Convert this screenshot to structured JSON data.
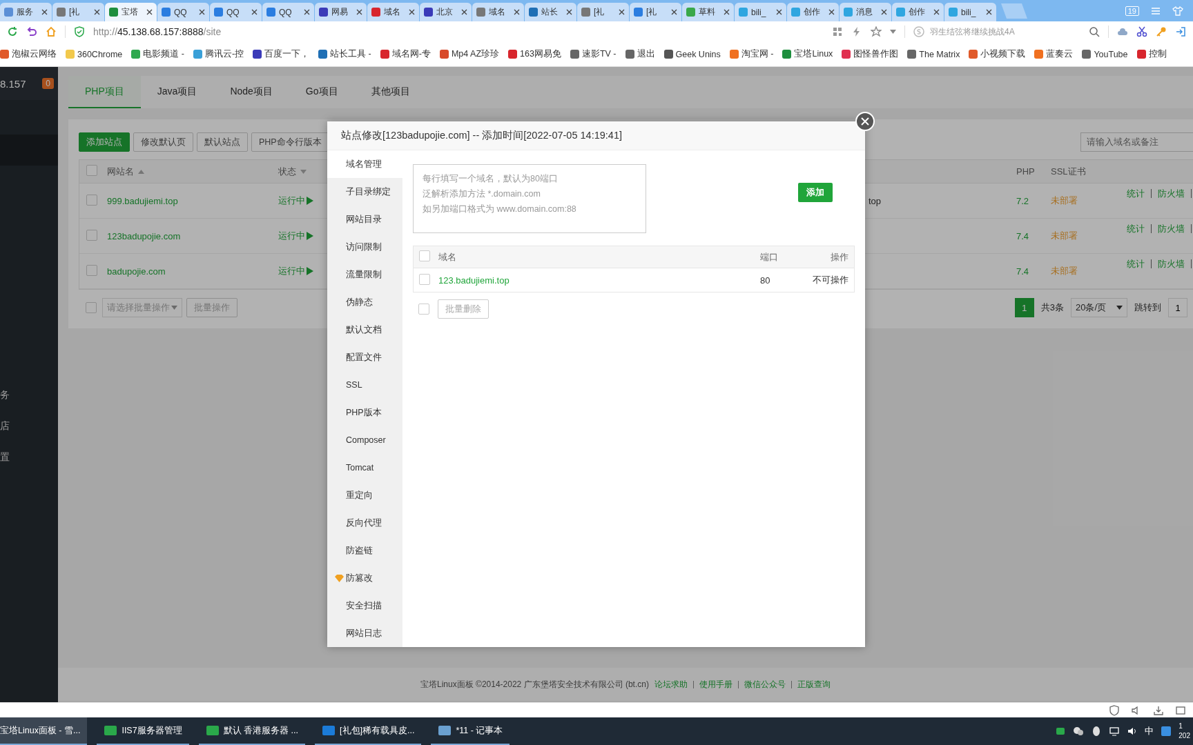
{
  "browser": {
    "tabs": [
      {
        "title": "服务",
        "color": "#5b8fd6",
        "selected": false
      },
      {
        "title": "[礼",
        "color": "#777777",
        "selected": false
      },
      {
        "title": "宝塔",
        "color": "#1e8e3e",
        "selected": true
      },
      {
        "title": "QQ",
        "color": "#2b7de0",
        "selected": false
      },
      {
        "title": "QQ",
        "color": "#2b7de0",
        "selected": false
      },
      {
        "title": "QQ",
        "color": "#2b7de0",
        "selected": false
      },
      {
        "title": "网易",
        "color": "#3b3bb8",
        "selected": false
      },
      {
        "title": "域名",
        "color": "#d8262d",
        "selected": false
      },
      {
        "title": "北京",
        "color": "#3b3bb8",
        "selected": false
      },
      {
        "title": "域名",
        "color": "#777777",
        "selected": false
      },
      {
        "title": "站长",
        "color": "#1f6fb5",
        "selected": false
      },
      {
        "title": "[礼",
        "color": "#777777",
        "selected": false
      },
      {
        "title": "[礼",
        "color": "#2b7de0",
        "selected": false
      },
      {
        "title": "草料",
        "color": "#3aa84a",
        "selected": false
      },
      {
        "title": "bili_",
        "color": "#2fa6e0",
        "selected": false
      },
      {
        "title": "创作",
        "color": "#2fa6e0",
        "selected": false
      },
      {
        "title": "消息",
        "color": "#2fa6e0",
        "selected": false
      },
      {
        "title": "创作",
        "color": "#2fa6e0",
        "selected": false
      },
      {
        "title": "bili_",
        "color": "#2fa6e0",
        "selected": false
      }
    ],
    "tab_count": "19",
    "address": {
      "scheme": "http://",
      "host": "45.138.68.157:8888",
      "path": "/site"
    },
    "search": {
      "placeholder": "羽生结弦将继续挑战4A"
    },
    "bookmarks": [
      {
        "label": "泡椒云网络",
        "color": "#e05a2a"
      },
      {
        "label": "360Chrome",
        "color": "#f2c94c"
      },
      {
        "label": "电影频道 -",
        "color": "#2fa84f"
      },
      {
        "label": "腾讯云-控",
        "color": "#3aa0d8"
      },
      {
        "label": "百度一下，",
        "color": "#3b3bb8"
      },
      {
        "label": "站长工具 -",
        "color": "#1f6fb5"
      },
      {
        "label": "域名网-专",
        "color": "#d8262d"
      },
      {
        "label": "Mp4 AZ珍珍",
        "color": "#d84a2a"
      },
      {
        "label": "163网易免",
        "color": "#d8262d"
      },
      {
        "label": "速影TV -",
        "color": "#666666"
      },
      {
        "label": "退出",
        "color": "#666666"
      },
      {
        "label": "Geek Unins",
        "color": "#555555"
      },
      {
        "label": "淘宝网 -",
        "color": "#f07020"
      },
      {
        "label": "宝塔Linux",
        "color": "#1e8e3e"
      },
      {
        "label": "图怪兽作图",
        "color": "#e03050"
      },
      {
        "label": "The Matrix",
        "color": "#666666"
      },
      {
        "label": "小视频下载",
        "color": "#e05a2a"
      },
      {
        "label": "蓝奏云",
        "color": "#f07020"
      },
      {
        "label": "YouTube",
        "color": "#666666"
      },
      {
        "label": "控制",
        "color": "#d8262d"
      }
    ]
  },
  "sidebar": {
    "server": "8.157",
    "badge": "0",
    "items": [
      {
        "label": "务"
      },
      {
        "label": "店"
      },
      {
        "label": "置"
      }
    ]
  },
  "project_tabs": [
    {
      "label": "PHP项目",
      "selected": true
    },
    {
      "label": "Java项目",
      "selected": false
    },
    {
      "label": "Node项目",
      "selected": false
    },
    {
      "label": "Go项目",
      "selected": false
    },
    {
      "label": "其他项目",
      "selected": false
    }
  ],
  "toolbar": {
    "buttons": [
      {
        "label": "添加站点",
        "kind": "primary"
      },
      {
        "label": "修改默认页",
        "kind": "default"
      },
      {
        "label": "默认站点",
        "kind": "default"
      },
      {
        "label": "PHP命令行版本",
        "kind": "default"
      }
    ],
    "search": {
      "placeholder": "请输入域名或备注"
    }
  },
  "sites_table": {
    "select_all": {
      "checked": false
    },
    "columns": [
      {
        "label": "网站名",
        "kind": "sort_up"
      },
      {
        "label": "状态",
        "kind": "sort_down"
      },
      {
        "label": "PHP",
        "kind": "plain"
      },
      {
        "label": "SSL证书",
        "kind": "plain"
      }
    ],
    "rows": [
      {
        "checked": false,
        "name": "999.badujiemi.top",
        "status": "运行中",
        "column_3": "top",
        "php": "7.2",
        "ssl": "未部署",
        "actions": [
          "统计",
          "防火墙"
        ]
      },
      {
        "checked": false,
        "name": "123badupojie.com",
        "status": "运行中",
        "php": "7.4",
        "ssl": "未部署",
        "actions": [
          "统计",
          "防火墙"
        ]
      },
      {
        "checked": false,
        "name": "badupojie.com",
        "status": "运行中",
        "php": "7.4",
        "ssl": "未部署",
        "actions": [
          "统计",
          "防火墙"
        ]
      }
    ]
  },
  "batch": {
    "checked": false,
    "placeholder": "请选择批量操作",
    "button": {
      "label": "批量操作",
      "disabled": true
    }
  },
  "pagination": {
    "pages": [
      {
        "label": "1",
        "selected": true
      }
    ],
    "total": "共3条",
    "page_size": "20条/页",
    "jump_label": "跳转到",
    "jump_value": "1"
  },
  "dialog": {
    "title": "站点修改[123badupojie.com] -- 添加时间[2022-07-05 14:19:41]",
    "menu": [
      {
        "label": "域名管理",
        "selected": true,
        "kind": "plain"
      },
      {
        "label": "子目录绑定",
        "selected": false,
        "kind": "plain"
      },
      {
        "label": "网站目录",
        "selected": false,
        "kind": "plain"
      },
      {
        "label": "访问限制",
        "selected": false,
        "kind": "plain"
      },
      {
        "label": "流量限制",
        "selected": false,
        "kind": "plain"
      },
      {
        "label": "伪静态",
        "selected": false,
        "kind": "plain"
      },
      {
        "label": "默认文档",
        "selected": false,
        "kind": "plain"
      },
      {
        "label": "配置文件",
        "selected": false,
        "kind": "plain"
      },
      {
        "label": "SSL",
        "selected": false,
        "kind": "plain"
      },
      {
        "label": "PHP版本",
        "selected": false,
        "kind": "plain"
      },
      {
        "label": "Composer",
        "selected": false,
        "kind": "plain"
      },
      {
        "label": "Tomcat",
        "selected": false,
        "kind": "plain"
      },
      {
        "label": "重定向",
        "selected": false,
        "kind": "plain"
      },
      {
        "label": "反向代理",
        "selected": false,
        "kind": "plain"
      },
      {
        "label": "防盗链",
        "selected": false,
        "kind": "plain"
      },
      {
        "label": "防篡改",
        "selected": false,
        "kind": "premium"
      },
      {
        "label": "安全扫描",
        "selected": false,
        "kind": "plain"
      },
      {
        "label": "网站日志",
        "selected": false,
        "kind": "plain"
      }
    ],
    "domain_input": {
      "placeholder_lines": [
        "每行填写一个域名，默认为80端口",
        "泛解析添加方法 *.domain.com",
        "如另加端口格式为 www.domain.com:88"
      ]
    },
    "add_button": "添加",
    "domain_table": {
      "select_all": {
        "checked": false
      },
      "columns": [
        "域名",
        "端口",
        "操作"
      ],
      "rows": [
        {
          "checked": false,
          "domain": "123.badujiemi.top",
          "port": "80",
          "action": "不可操作"
        }
      ]
    },
    "batch_delete": {
      "checked": false,
      "label": "批量删除",
      "disabled": true
    }
  },
  "footer": {
    "copyright": "宝塔Linux面板 ©2014-2022 广东堡塔安全技术有限公司 (bt.cn)",
    "links": [
      "论坛求助",
      "使用手册",
      "微信公众号",
      "正版查询"
    ]
  },
  "taskbar": {
    "items": [
      {
        "label": "宝塔Linux面板 - 雪...",
        "selected": true
      },
      {
        "label": "IIS7服务器管理",
        "selected": false
      },
      {
        "label": "默认  香港服务器 ...",
        "selected": false
      },
      {
        "label": "[礼包]稀有载具皮...",
        "selected": false
      },
      {
        "label": "*11 - 记事本",
        "selected": false
      }
    ],
    "ime": "中",
    "clock": {
      "time": "1",
      "date": "202"
    }
  }
}
